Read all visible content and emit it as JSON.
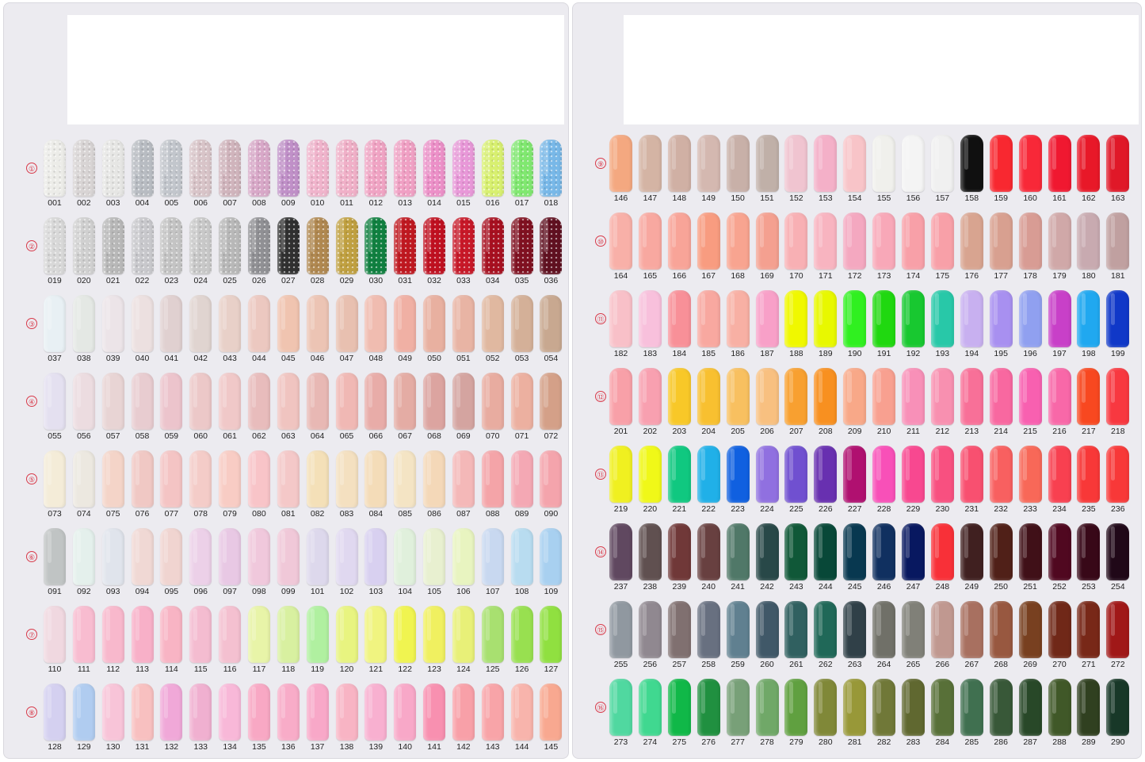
{
  "left_board": {
    "rows": [
      {
        "marker": "①",
        "codes": [
          "001",
          "002",
          "003",
          "004",
          "005",
          "006",
          "007",
          "008",
          "009",
          "010",
          "011",
          "012",
          "013",
          "014",
          "015",
          "016",
          "017",
          "018"
        ],
        "colors": [
          "#ecece8",
          "#d8d4d4",
          "#e6e6e4",
          "#b8bcc2",
          "#c2c6cc",
          "#d8c4c8",
          "#d0b4bc",
          "#d8a8c8",
          "#c090c8",
          "#f0b4cc",
          "#f0b0c8",
          "#f0a4c4",
          "#f0a0c4",
          "#ec90c8",
          "#e898d8",
          "#d8f070",
          "#80e870",
          "#78b8e8"
        ],
        "glitter": true
      },
      {
        "marker": "②",
        "codes": [
          "019",
          "020",
          "021",
          "022",
          "023",
          "024",
          "025",
          "026",
          "027",
          "028",
          "029",
          "030",
          "031",
          "032",
          "033",
          "034",
          "035",
          "036"
        ],
        "colors": [
          "#d8d8d8",
          "#d0d0d0",
          "#b8b8b8",
          "#c8c8cc",
          "#c4c4c4",
          "#c8c8c8",
          "#b8b8b8",
          "#909094",
          "#303030",
          "#b08850",
          "#c0a040",
          "#108040",
          "#c01820",
          "#c01020",
          "#c81828",
          "#a81020",
          "#801020",
          "#601020"
        ],
        "glitter": true
      },
      {
        "marker": "③",
        "codes": [
          "037",
          "038",
          "039",
          "040",
          "041",
          "042",
          "043",
          "044",
          "045",
          "046",
          "047",
          "048",
          "049",
          "050",
          "051",
          "052",
          "053",
          "054"
        ],
        "colors": [
          "#e8f0f4",
          "#e4e8e4",
          "#ece4e8",
          "#ece0e0",
          "#e0d0d0",
          "#e0d4d0",
          "#e8d0c8",
          "#ecc8c0",
          "#f0c4b0",
          "#ecc4b4",
          "#e8c0b0",
          "#f0bcb0",
          "#f0b0a4",
          "#e8b0a0",
          "#e8b4a4",
          "#e0b8a0",
          "#d4b098",
          "#c8a890"
        ],
        "glitter": false
      },
      {
        "marker": "④",
        "codes": [
          "055",
          "056",
          "057",
          "058",
          "059",
          "060",
          "061",
          "062",
          "063",
          "064",
          "065",
          "066",
          "067",
          "068",
          "069",
          "070",
          "071",
          "072"
        ],
        "colors": [
          "#e4e0f0",
          "#ecdce0",
          "#e8d4d4",
          "#e8ccd0",
          "#ecc4cc",
          "#ecc8c8",
          "#f0c8c8",
          "#e8bcbc",
          "#f0c4c0",
          "#e8b8b4",
          "#f0b8b4",
          "#e8aca8",
          "#e4aca4",
          "#dca4a0",
          "#d4a4a0",
          "#e8aca0",
          "#ecb0a0",
          "#d4a088"
        ],
        "glitter": false
      },
      {
        "marker": "⑤",
        "codes": [
          "073",
          "074",
          "075",
          "076",
          "077",
          "078",
          "079",
          "080",
          "081",
          "082",
          "083",
          "084",
          "085",
          "086",
          "087",
          "088",
          "089",
          "090"
        ],
        "colors": [
          "#f4ecd8",
          "#ece8e0",
          "#f4d4c8",
          "#f0c8c4",
          "#f4c4c4",
          "#f4ccc8",
          "#f8ccc4",
          "#f8c4c8",
          "#f4c8c8",
          "#f4e0b8",
          "#f4e0c0",
          "#f4dcb8",
          "#f4e4c4",
          "#f4d8b8",
          "#f4b8b8",
          "#f4a4a8",
          "#f4a8b4",
          "#f4a4ac"
        ],
        "glitter": false
      },
      {
        "marker": "⑥",
        "codes": [
          "091",
          "092",
          "093",
          "094",
          "095",
          "096",
          "097",
          "098",
          "099",
          "101",
          "102",
          "103",
          "104",
          "105",
          "106",
          "107",
          "108",
          "109"
        ],
        "colors": [
          "#c0c4c4",
          "#e4f0ec",
          "#e0e4ec",
          "#f0d8d4",
          "#f0d4d0",
          "#ecd0e8",
          "#e8c8e4",
          "#f0c8dc",
          "#f0c8d8",
          "#ddd8ec",
          "#e0d8f0",
          "#d8d0f0",
          "#e0f0dc",
          "#e8f0d0",
          "#e8f4c0",
          "#c8d8f0",
          "#b8dcf0",
          "#a8d0f0"
        ],
        "glitter": false
      },
      {
        "marker": "⑦",
        "codes": [
          "110",
          "111",
          "112",
          "113",
          "114",
          "115",
          "116",
          "117",
          "118",
          "119",
          "120",
          "121",
          "122",
          "123",
          "124",
          "125",
          "126",
          "127"
        ],
        "colors": [
          "#f0d8e0",
          "#f8bcd0",
          "#f8b8cc",
          "#f8b0c8",
          "#f8b4c4",
          "#f4bcd0",
          "#f4c0d0",
          "#e8f4a8",
          "#d8f0a0",
          "#b0f0a0",
          "#e8f480",
          "#f0f480",
          "#f0f450",
          "#f0f060",
          "#e8f078",
          "#a8e070",
          "#98e050",
          "#90e040"
        ],
        "glitter": false
      },
      {
        "marker": "⑧",
        "codes": [
          "128",
          "129",
          "130",
          "131",
          "132",
          "133",
          "134",
          "135",
          "136",
          "137",
          "138",
          "139",
          "140",
          "141",
          "142",
          "143",
          "144",
          "145"
        ],
        "colors": [
          "#d4d0f0",
          "#b0ccf0",
          "#f8c4d8",
          "#f8c0c0",
          "#f0a8d8",
          "#f0b0d0",
          "#f8b8d8",
          "#f8a8c4",
          "#f8acc8",
          "#f8a8c8",
          "#f8b4c4",
          "#f8b0d0",
          "#f8a8c8",
          "#f890b0",
          "#f8a0a8",
          "#f8a4a8",
          "#f8b4ac",
          "#f8a890"
        ],
        "glitter": false
      }
    ]
  },
  "right_board": {
    "rows": [
      {
        "marker": "⑨",
        "codes": [
          "146",
          "147",
          "148",
          "149",
          "150",
          "151",
          "152",
          "153",
          "154",
          "155",
          "156",
          "157",
          "158",
          "159",
          "160",
          "161",
          "162",
          "163"
        ],
        "colors": [
          "#f4a880",
          "#d4b4a4",
          "#d0b0a4",
          "#d4b8b0",
          "#c8b0a8",
          "#c0b0a8",
          "#f0c4d0",
          "#f4b0c8",
          "#f8c4c8",
          "#f0f0ec",
          "#f4f4f4",
          "#f0f0f0",
          "#101010",
          "#f82830",
          "#f82838",
          "#f01830",
          "#e81828",
          "#e01828"
        ],
        "glitter": false
      },
      {
        "marker": "⑩",
        "codes": [
          "164",
          "165",
          "166",
          "167",
          "168",
          "169",
          "170",
          "171",
          "172",
          "173",
          "174",
          "175",
          "176",
          "177",
          "178",
          "179",
          "180",
          "181"
        ],
        "colors": [
          "#f8b0a8",
          "#f8a8a0",
          "#f8a498",
          "#f89c80",
          "#f8a490",
          "#f4a090",
          "#f8b0b4",
          "#f8b4c0",
          "#f4a8c0",
          "#f8a8b8",
          "#f8a0a8",
          "#f8a0a8",
          "#d8a490",
          "#d8a090",
          "#d89c94",
          "#d0a8a8",
          "#c8aab0",
          "#c0a0a0"
        ],
        "glitter": false
      },
      {
        "marker": "⑪",
        "codes": [
          "182",
          "183",
          "184",
          "185",
          "186",
          "187",
          "188",
          "189",
          "190",
          "191",
          "192",
          "193",
          "194",
          "195",
          "196",
          "197",
          "198",
          "199"
        ],
        "colors": [
          "#f8c0c8",
          "#f8c0dc",
          "#f89098",
          "#f8a8a0",
          "#f8b0a4",
          "#f8a0c8",
          "#f0f800",
          "#e8f800",
          "#30f020",
          "#20d810",
          "#18c830",
          "#28c8a8",
          "#c8b0f0",
          "#a890f0",
          "#90a0f0",
          "#c840c8",
          "#20a8f0",
          "#1038c8"
        ],
        "glitter": false
      },
      {
        "marker": "⑫",
        "codes": [
          "201",
          "202",
          "203",
          "204",
          "205",
          "206",
          "207",
          "208",
          "209",
          "210",
          "211",
          "212",
          "213",
          "214",
          "215",
          "216",
          "217",
          "218"
        ],
        "colors": [
          "#f8a0a8",
          "#f8a0b0",
          "#f8c828",
          "#f8c030",
          "#f8c060",
          "#f8c080",
          "#f8a030",
          "#f89020",
          "#f8a888",
          "#f8a090",
          "#f890b8",
          "#f890b0",
          "#f87098",
          "#f868a0",
          "#f860b0",
          "#f868a8",
          "#f84820",
          "#f83840"
        ],
        "glitter": false
      },
      {
        "marker": "⑬",
        "codes": [
          "219",
          "220",
          "221",
          "222",
          "223",
          "224",
          "225",
          "226",
          "227",
          "228",
          "229",
          "230",
          "231",
          "232",
          "233",
          "234",
          "235",
          "236"
        ],
        "colors": [
          "#f0f020",
          "#f0f818",
          "#10c880",
          "#20b0e8",
          "#1060e0",
          "#9070e0",
          "#7050d0",
          "#6830b0",
          "#b01070",
          "#f850b8",
          "#f84890",
          "#f85080",
          "#f85070",
          "#f86060",
          "#f86858",
          "#f84050",
          "#f83838",
          "#f83838"
        ],
        "glitter": false
      },
      {
        "marker": "⑭",
        "codes": [
          "237",
          "238",
          "239",
          "240",
          "241",
          "242",
          "243",
          "244",
          "245",
          "246",
          "247",
          "248",
          "249",
          "250",
          "251",
          "252",
          "253",
          "254"
        ],
        "colors": [
          "#604860",
          "#605050",
          "#703838",
          "#684040",
          "#507868",
          "#284848",
          "#105838",
          "#084838",
          "#083850",
          "#103060",
          "#081860",
          "#f83038",
          "#402020",
          "#502018",
          "#401018",
          "#500820",
          "#380818",
          "#200818"
        ],
        "glitter": false
      },
      {
        "marker": "⑮",
        "codes": [
          "255",
          "256",
          "257",
          "258",
          "259",
          "260",
          "261",
          "262",
          "263",
          "264",
          "265",
          "266",
          "267",
          "268",
          "269",
          "270",
          "271",
          "272"
        ],
        "colors": [
          "#9098a0",
          "#908890",
          "#807070",
          "#687080",
          "#608090",
          "#405868",
          "#306060",
          "#206858",
          "#304048",
          "#707068",
          "#808078",
          "#c09890",
          "#a87060",
          "#985840",
          "#784020",
          "#702818",
          "#782818",
          "#a01818"
        ],
        "glitter": false
      },
      {
        "marker": "⑯",
        "codes": [
          "273",
          "274",
          "275",
          "276",
          "277",
          "278",
          "279",
          "280",
          "281",
          "282",
          "283",
          "284",
          "285",
          "286",
          "287",
          "288",
          "289",
          "290"
        ],
        "colors": [
          "#50d8a0",
          "#40d890",
          "#10b848",
          "#209040",
          "#78a078",
          "#70a868",
          "#60a040",
          "#808838",
          "#989838",
          "#707838",
          "#606830",
          "#587038",
          "#407050",
          "#385838",
          "#284828",
          "#405828",
          "#304020",
          "#183828"
        ],
        "glitter": false
      }
    ]
  }
}
